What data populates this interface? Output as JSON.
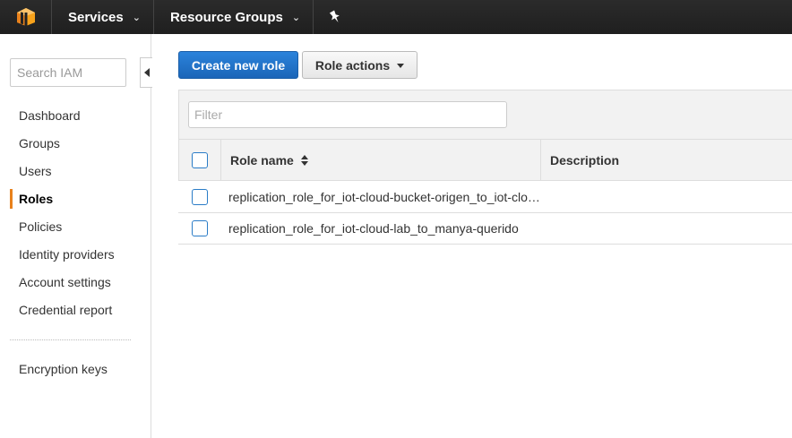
{
  "topbar": {
    "logo_icon": "aws-cube-icon",
    "services_label": "Services",
    "resource_groups_label": "Resource Groups",
    "pin_icon": "pushpin-icon",
    "accent_color": "#e8811c"
  },
  "sidebar": {
    "search_placeholder": "Search IAM",
    "items": [
      {
        "label": "Dashboard"
      },
      {
        "label": "Groups"
      },
      {
        "label": "Users"
      },
      {
        "label": "Roles",
        "active": true
      },
      {
        "label": "Policies"
      },
      {
        "label": "Identity providers"
      },
      {
        "label": "Account settings"
      },
      {
        "label": "Credential report"
      }
    ],
    "encryption_keys_label": "Encryption keys"
  },
  "toolbar": {
    "create_label": "Create new role",
    "actions_label": "Role actions"
  },
  "filter": {
    "placeholder": "Filter"
  },
  "table": {
    "columns": [
      "Role name",
      "Description"
    ],
    "rows": [
      {
        "role_name": "replication_role_for_iot-cloud-bucket-origen_to_iot-cloud-bucket-destino",
        "description": ""
      },
      {
        "role_name": "replication_role_for_iot-cloud-lab_to_manya-querido",
        "description": ""
      }
    ]
  }
}
